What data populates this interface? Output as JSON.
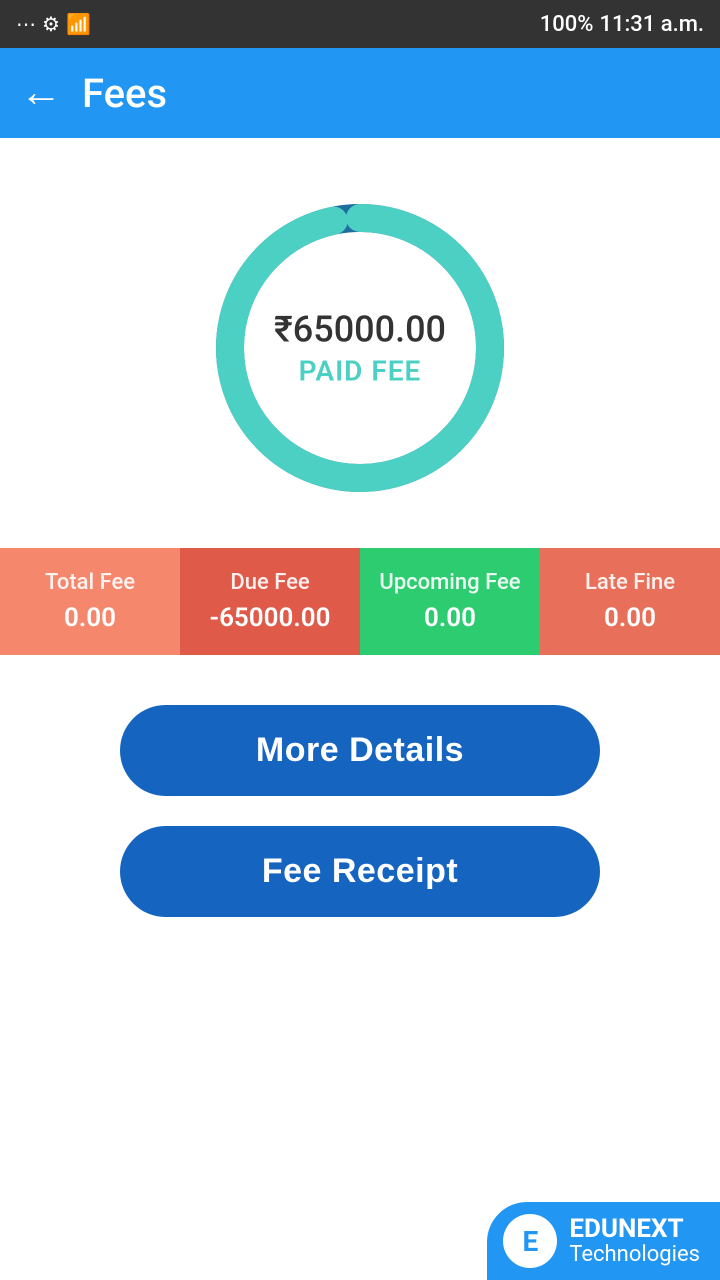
{
  "statusBar": {
    "time": "11:31 a.m.",
    "battery": "100%"
  },
  "header": {
    "title": "Fees",
    "backLabel": "←"
  },
  "chart": {
    "amount": "₹65000.00",
    "label": "PAID FEE",
    "paidPercent": 97,
    "color_paid": "#4DD0C4",
    "color_due": "#1E6E9E"
  },
  "feeSummary": [
    {
      "label": "Total Fee",
      "value": "0.00"
    },
    {
      "label": "Due Fee",
      "value": "-65000.00"
    },
    {
      "label": "Upcoming Fee",
      "value": "0.00"
    },
    {
      "label": "Late Fine",
      "value": "0.00"
    }
  ],
  "buttons": [
    {
      "label": "More Details"
    },
    {
      "label": "Fee Receipt"
    }
  ],
  "brand": {
    "name": "EDUNEXT",
    "sub": "Technologies",
    "icon": "E"
  }
}
